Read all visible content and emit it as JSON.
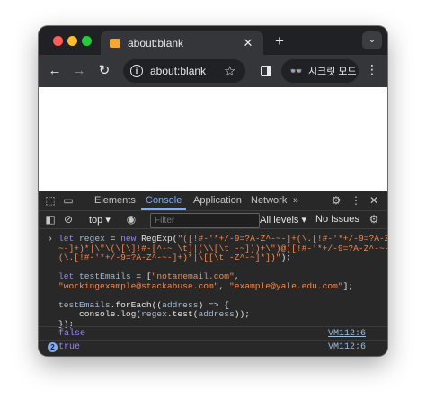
{
  "tab": {
    "title": "about:blank",
    "close": "✕",
    "new_tab": "+"
  },
  "toolbar": {
    "back": "←",
    "forward": "→",
    "reload": "↻",
    "url": "about:blank",
    "incognito_label": "시크릿 모드"
  },
  "devtools": {
    "tabs": [
      "Elements",
      "Console",
      "Application",
      "Network"
    ],
    "more_tabs": "»",
    "active_tab": "Console",
    "context": "top",
    "filter_placeholder": "Filter",
    "levels": "All levels ▾",
    "issues": "No Issues"
  },
  "console": {
    "input_lines": [
      "let regex = new RegExp(\"([!#-'*+/-9=?A-Z^-~-]+(\\.[!#-'*+/-9=?A-Z^-~-",
      "~-]+)*|\\\"\\(\\[\\]!#-[^-~ \\t]|(\\\\[\\t -~]))+\\\")@([!#-'*+/-9=?A-Z^-~-]+",
      "(\\.[!#-'*+/-9=?A-Z^-~-]+)*|\\[[\\t -Z^-~]*])\");",
      "",
      "let testEmails = [\"notanemail.com\",",
      "\"workingexample@stackabuse.com\", \"example@yale.edu.com\"];",
      "",
      "testEmails.forEach((address) => {",
      "    console.log(regex.test(address));",
      "});"
    ],
    "outputs": [
      {
        "value": "false",
        "source": "VM112:6",
        "count": ""
      },
      {
        "value": "true",
        "source": "VM112:6",
        "count": "2"
      }
    ]
  },
  "colors": {
    "keyword": "#9980ff",
    "string": "#f28b54",
    "variable": "#9bbbdc",
    "accent": "#7cacf8"
  }
}
